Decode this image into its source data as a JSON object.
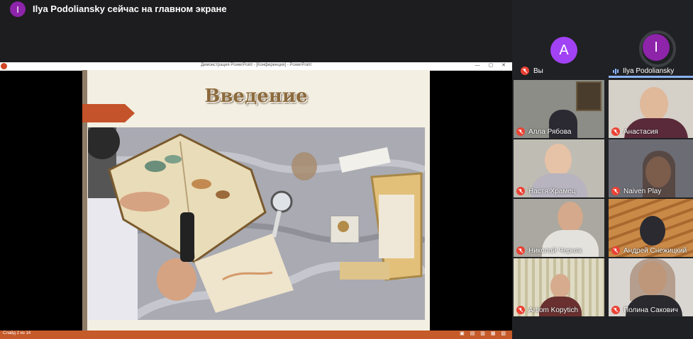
{
  "presenter": {
    "initial": "I",
    "banner": "Ilya Podoliansky сейчас на главном экране"
  },
  "share": {
    "window_title": "Демонстрация PowerPoint - [Конференция] - PowerPoint",
    "window_controls": "— ▢ ✕",
    "slide_title": "Введение",
    "status_left": "Слайд 2 из 14",
    "status_right_icons": "▣ ▤ ▥ ▦ ▧"
  },
  "participants": [
    {
      "name": "Вы",
      "initial": "A",
      "color": "#a142f4"
    },
    {
      "name": "Ilya Podoliansky",
      "initial": "I",
      "color": "#8e24aa",
      "speaking": true
    }
  ],
  "video_tiles": [
    {
      "name": "Алла Рябова"
    },
    {
      "name": "Анастасия"
    },
    {
      "name": "Настя Храмец"
    },
    {
      "name": "Naiven Play"
    },
    {
      "name": "Николай Черняк"
    },
    {
      "name": "Андрей Снежицкий"
    },
    {
      "name": "Artiom Kopytich"
    },
    {
      "name": "Полина Сакович"
    }
  ],
  "colors": {
    "accent_active": "#8ab4f8",
    "mic_off": "#ea4335",
    "ppt_status": "#c55a2a"
  }
}
